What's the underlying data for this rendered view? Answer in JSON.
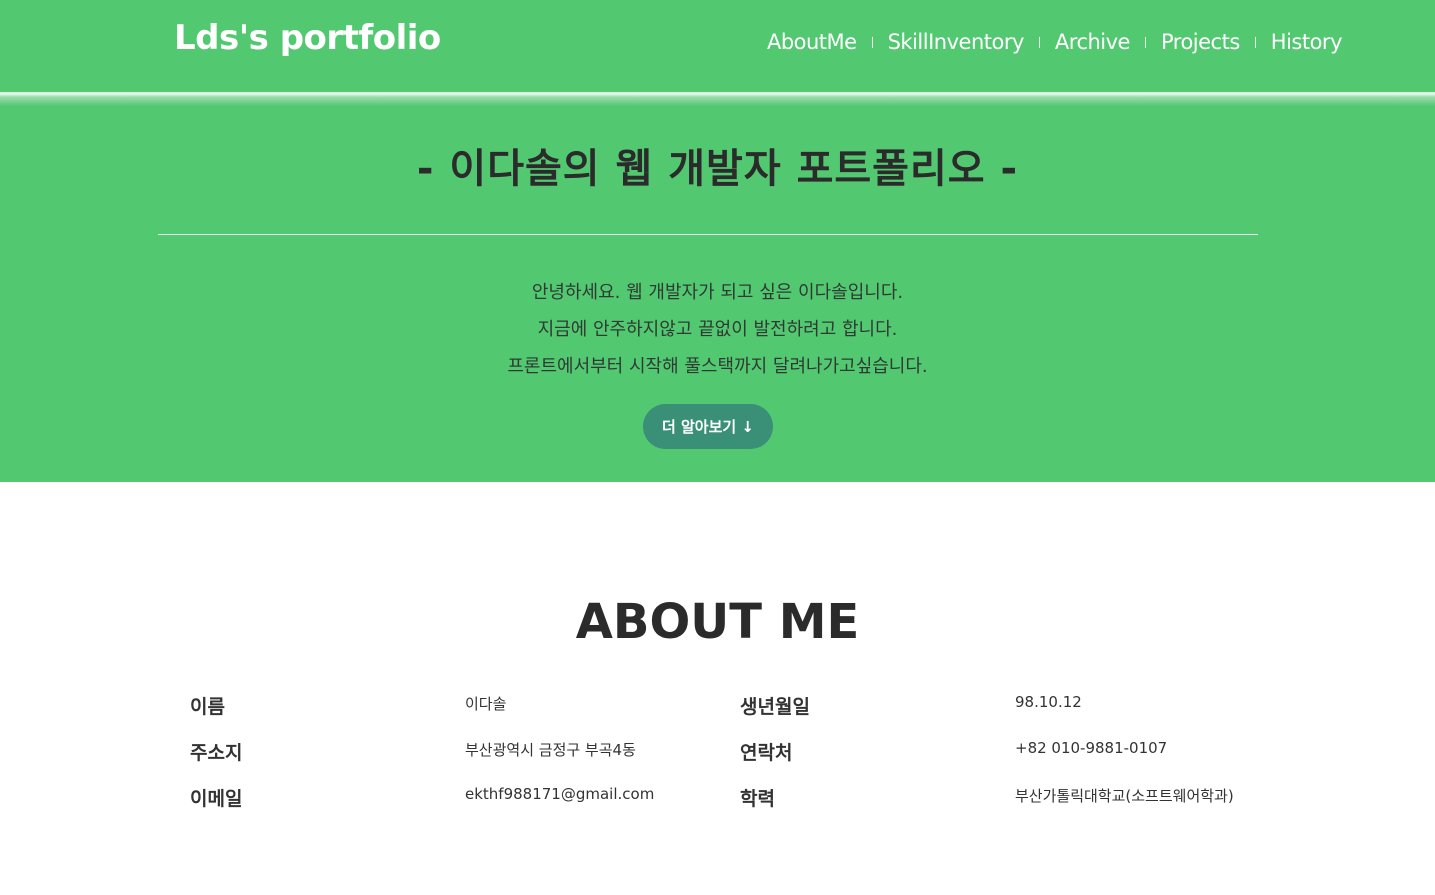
{
  "header": {
    "brand": "Lds's portfolio",
    "nav": [
      "AboutMe",
      "SkillInventory",
      "Archive",
      "Projects",
      "History"
    ]
  },
  "hero": {
    "title": "- 이다솔의 웹 개발자 포트폴리오 -",
    "lines": [
      "안녕하세요. 웹 개발자가 되고 싶은 이다솔입니다.",
      "지금에 안주하지않고 끝없이 발전하려고 합니다.",
      "프론트에서부터 시작해 풀스택까지 달려나가고싶습니다."
    ],
    "button_label": "더 알아보기 ↓"
  },
  "about": {
    "title": "ABOUT ME",
    "rows": [
      {
        "label": "이름",
        "value": "이다솔"
      },
      {
        "label": "생년월일",
        "value": "98.10.12"
      },
      {
        "label": "주소지",
        "value": "부산광역시 금정구 부곡4동"
      },
      {
        "label": "연락처",
        "value": "+82 010-9881-0107"
      },
      {
        "label": "이메일",
        "value": "ekthf988171@gmail.com"
      },
      {
        "label": "학력",
        "value": "부산가톨릭대학교(소프트웨어학과)"
      }
    ]
  },
  "colors": {
    "primary_green": "#52c971",
    "button_teal": "#3a8f77",
    "text_dark": "#333333"
  }
}
